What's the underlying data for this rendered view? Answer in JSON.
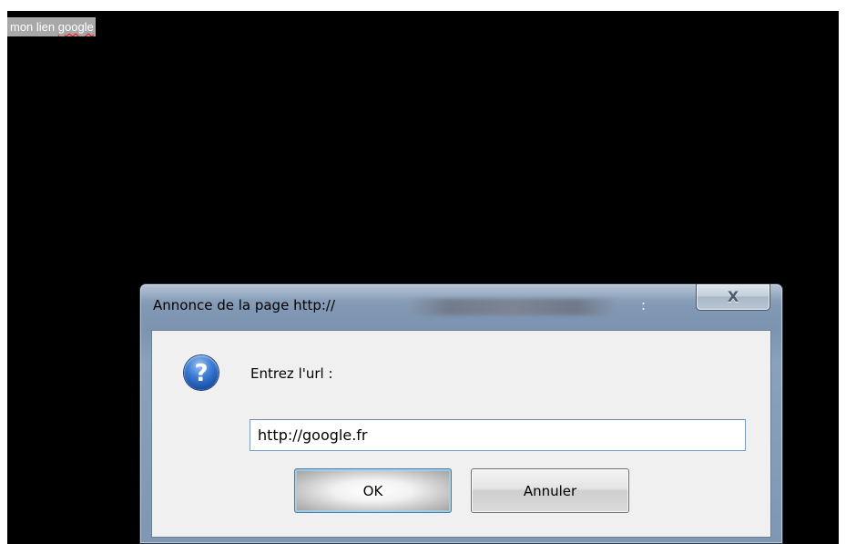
{
  "page": {
    "selected_text_prefix": "mon lien ",
    "selected_text_misspelled": "google"
  },
  "dialog": {
    "title": "Annonce de la page http://",
    "title_suffix": ":",
    "close_label": "X",
    "icon": "question-icon",
    "prompt": "Entrez l'url :",
    "input_value": "http://google.fr",
    "ok_label": "OK",
    "cancel_label": "Annuler"
  },
  "colors": {
    "page_background": "#000000",
    "selection_highlight": "#a8a8a8",
    "dialog_frame": "#7f97b3",
    "question_icon": "#3d7fd6"
  }
}
